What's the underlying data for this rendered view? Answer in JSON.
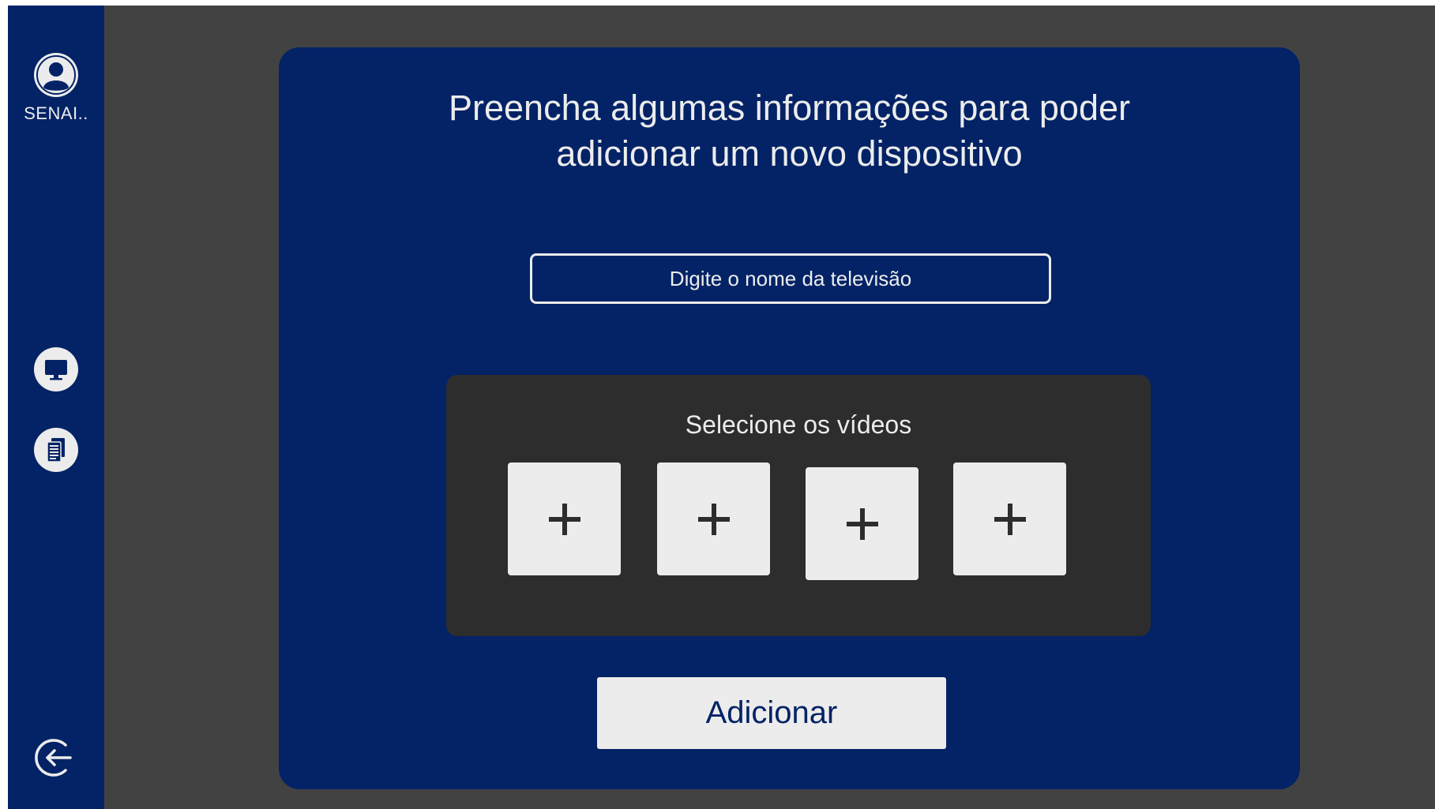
{
  "sidebar": {
    "username": "SENAI..",
    "icons": {
      "avatar": "user-avatar-icon",
      "tv": "monitor-icon",
      "docs": "document-list-icon",
      "logout": "logout-arrow-icon"
    }
  },
  "form": {
    "title_line1": "Preencha algumas informações para poder",
    "title_line2": "adicionar um novo dispositivo",
    "tv_name_placeholder": "Digite o nome da televisão",
    "tv_name_value": "",
    "videos_title": "Selecione os vídeos",
    "video_slots": [
      "+",
      "+",
      "+",
      "+"
    ],
    "submit_label": "Adicionar"
  },
  "colors": {
    "primary": "#032366",
    "background": "#424242",
    "panel": "#2d2d2d",
    "light": "#ececec"
  }
}
